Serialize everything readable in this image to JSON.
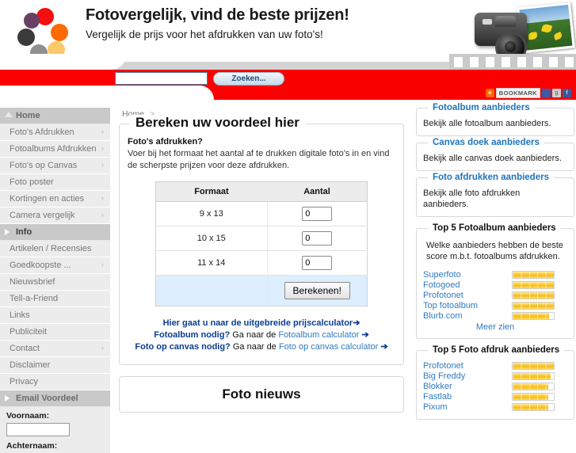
{
  "header": {
    "title": "Fotovergelijk, vind de beste prijzen!",
    "subtitle": "Vergelijk de prijs voor het afdrukken van uw foto's!",
    "logo_icon": "colored-dots-ring-logo",
    "camera_icon": "camera-photo-image"
  },
  "search": {
    "value": "",
    "placeholder": "",
    "button_label": "Zoeken...",
    "bookmark_label": "BOOKMARK",
    "bookmark_plus": "+"
  },
  "sidebar": {
    "items": [
      {
        "label": "Home",
        "type": "section",
        "icon": "home-icon",
        "chevron": false
      },
      {
        "label": "Foto's Afdrukken",
        "type": "item",
        "chevron": true
      },
      {
        "label": "Fotoalbums Afdrukken",
        "type": "item",
        "chevron": true
      },
      {
        "label": "Foto's op Canvas",
        "type": "item",
        "chevron": true
      },
      {
        "label": "Foto poster",
        "type": "item",
        "chevron": false
      },
      {
        "label": "Kortingen en acties",
        "type": "item",
        "chevron": true
      },
      {
        "label": "Camera vergelijk",
        "type": "item",
        "chevron": true
      },
      {
        "label": "Info",
        "type": "section",
        "icon": "arrow-right-icon",
        "chevron": false
      },
      {
        "label": "Artikelen / Recensies",
        "type": "item",
        "chevron": false
      },
      {
        "label": "Goedkoopste ...",
        "type": "item",
        "chevron": true
      },
      {
        "label": "Nieuwsbrief",
        "type": "item",
        "chevron": false
      },
      {
        "label": "Tell-a-Friend",
        "type": "item",
        "chevron": false
      },
      {
        "label": "Links",
        "type": "item",
        "chevron": false
      },
      {
        "label": "Publiciteit",
        "type": "item",
        "chevron": false
      },
      {
        "label": "Contact",
        "type": "item",
        "chevron": true
      },
      {
        "label": "Disclaimer",
        "type": "item",
        "chevron": false
      },
      {
        "label": "Privacy",
        "type": "item",
        "chevron": false
      },
      {
        "label": "Email Voordeel",
        "type": "section",
        "icon": "arrow-right-icon",
        "chevron": false
      }
    ],
    "form": {
      "firstname_label": "Voornaam:",
      "firstname_value": "",
      "lastname_label": "Achternaam:"
    }
  },
  "main": {
    "breadcrumb": "Home",
    "breadcrumb_sep": ">",
    "legend": "Bereken uw voordeel hier",
    "question": "Foto's afdrukken?",
    "paragraph": "Voer bij het formaat het aantal af te drukken digitale foto's in en vind de scherpste prijzen voor deze afdrukken.",
    "table": {
      "headers": [
        "Formaat",
        "Aantal"
      ],
      "rows": [
        {
          "formaat": "9 x 13",
          "aantal": "0"
        },
        {
          "formaat": "10 x 15",
          "aantal": "0"
        },
        {
          "formaat": "11 x 14",
          "aantal": "0"
        }
      ],
      "button_label": "Berekenen!"
    },
    "links": [
      {
        "bold": "Hier gaat u naar de uitgebreide prijscalculator",
        "plain": "",
        "link": "",
        "arrow": "➔"
      },
      {
        "bold": "Fotoalbum nodig?",
        "plain": " Ga naar de ",
        "link": "Fotoalbum calculator",
        "arrow": "➔"
      },
      {
        "bold": "Foto op canvas nodig?",
        "plain": " Ga naar de ",
        "link": "Foto op canvas calculator",
        "arrow": "➔"
      }
    ],
    "news_title": "Foto nieuws"
  },
  "right": {
    "boxes": [
      {
        "title": "Fotoalbum aanbieders",
        "text": "Bekijk alle fotoalbum aanbieders."
      },
      {
        "title": "Canvas doek aanbieders",
        "text": "Bekijk alle canvas doek aanbieders."
      },
      {
        "title": "Foto afdrukken aanbieders",
        "text": "Bekijk alle foto afdrukken aanbieders."
      }
    ],
    "top_album": {
      "title": "Top 5 Fotoalbum aanbieders",
      "desc": "Welke aanbieders hebben de beste score m.b.t. fotoalbums afdrukken.",
      "more_label": "Meer zien",
      "rows": [
        {
          "name": "Superfoto",
          "rating": 100
        },
        {
          "name": "Fotogoed",
          "rating": 100
        },
        {
          "name": "Profotonet",
          "rating": 100
        },
        {
          "name": "Top fotoalbum",
          "rating": 100
        },
        {
          "name": "Blurb.com",
          "rating": 88
        }
      ]
    },
    "top_print": {
      "title": "Top 5 Foto afdruk aanbieders",
      "rows": [
        {
          "name": "Profotonet",
          "rating": 100
        },
        {
          "name": "Big Freddy",
          "rating": 92
        },
        {
          "name": "Blokker",
          "rating": 86
        },
        {
          "name": "Fastlab",
          "rating": 86
        },
        {
          "name": "Pixum",
          "rating": 86
        }
      ]
    }
  },
  "colors": {
    "red": "#fb0000",
    "link_blue": "#2f7bbf",
    "heading_blue": "#1d74bd",
    "gold": "#f5bd17",
    "sidebar_grey": "#ececec",
    "section_grey": "#c9c9c9"
  }
}
